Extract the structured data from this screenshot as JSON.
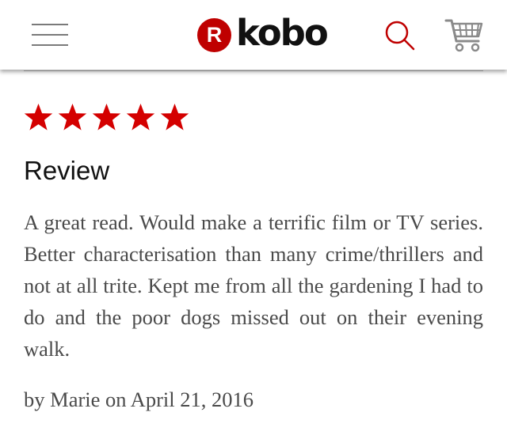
{
  "header": {
    "logo_badge": "R",
    "logo_text": "kobo",
    "brand_color": "#bf0000",
    "menu_icon": "hamburger-menu-icon",
    "search_icon": "search-icon",
    "cart_icon": "shopping-cart-icon"
  },
  "review": {
    "rating": 5,
    "rating_max": 5,
    "star_color": "#d40000",
    "heading": "Review",
    "body": "A great read. Would make a terrific film or TV series. Better characterisation than many crime/thrillers and not at all trite. Kept me from all the gardening I had to do and the poor dogs missed out on their evening walk.",
    "byline": "by Marie on April 21, 2016"
  }
}
